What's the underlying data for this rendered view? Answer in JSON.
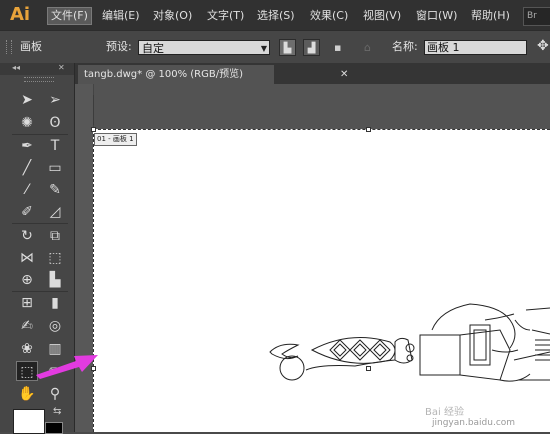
{
  "app": {
    "logo": "Ai",
    "bridge_label": "Br"
  },
  "menu": [
    "文件(F)",
    "编辑(E)",
    "对象(O)",
    "文字(T)",
    "选择(S)",
    "效果(C)",
    "视图(V)",
    "窗口(W)",
    "帮助(H)"
  ],
  "control_bar": {
    "panel_name": "画板",
    "preset_label": "预设:",
    "preset_value": "自定",
    "name_label": "名称:",
    "name_value": "画板 1"
  },
  "tools": [
    "selection-tool",
    "direct-selection-tool",
    "magic-wand-tool",
    "lasso-tool",
    "pen-tool",
    "type-tool",
    "line-segment-tool",
    "rectangle-tool",
    "paintbrush-tool",
    "pencil-tool",
    "blob-brush-tool",
    "eraser-tool",
    "rotate-tool",
    "scale-tool",
    "width-tool",
    "free-transform-tool",
    "shape-builder-tool",
    "perspective-grid-tool",
    "mesh-tool",
    "gradient-tool",
    "eyedropper-tool",
    "blend-tool",
    "symbol-sprayer-tool",
    "column-graph-tool",
    "artboard-tool",
    "slice-tool",
    "hand-tool",
    "zoom-tool"
  ],
  "document": {
    "tab_title": "tangb.dwg* @ 100% (RGB/预览)",
    "artboard_label": "01 - 画板 1"
  },
  "colors": {
    "annotation_arrow": "#e23be0",
    "menu_bg": "#313131",
    "logo": "#e8a33a"
  },
  "watermark": {
    "line1": "Bai 经验",
    "line2": "jingyan.baidu.com"
  }
}
